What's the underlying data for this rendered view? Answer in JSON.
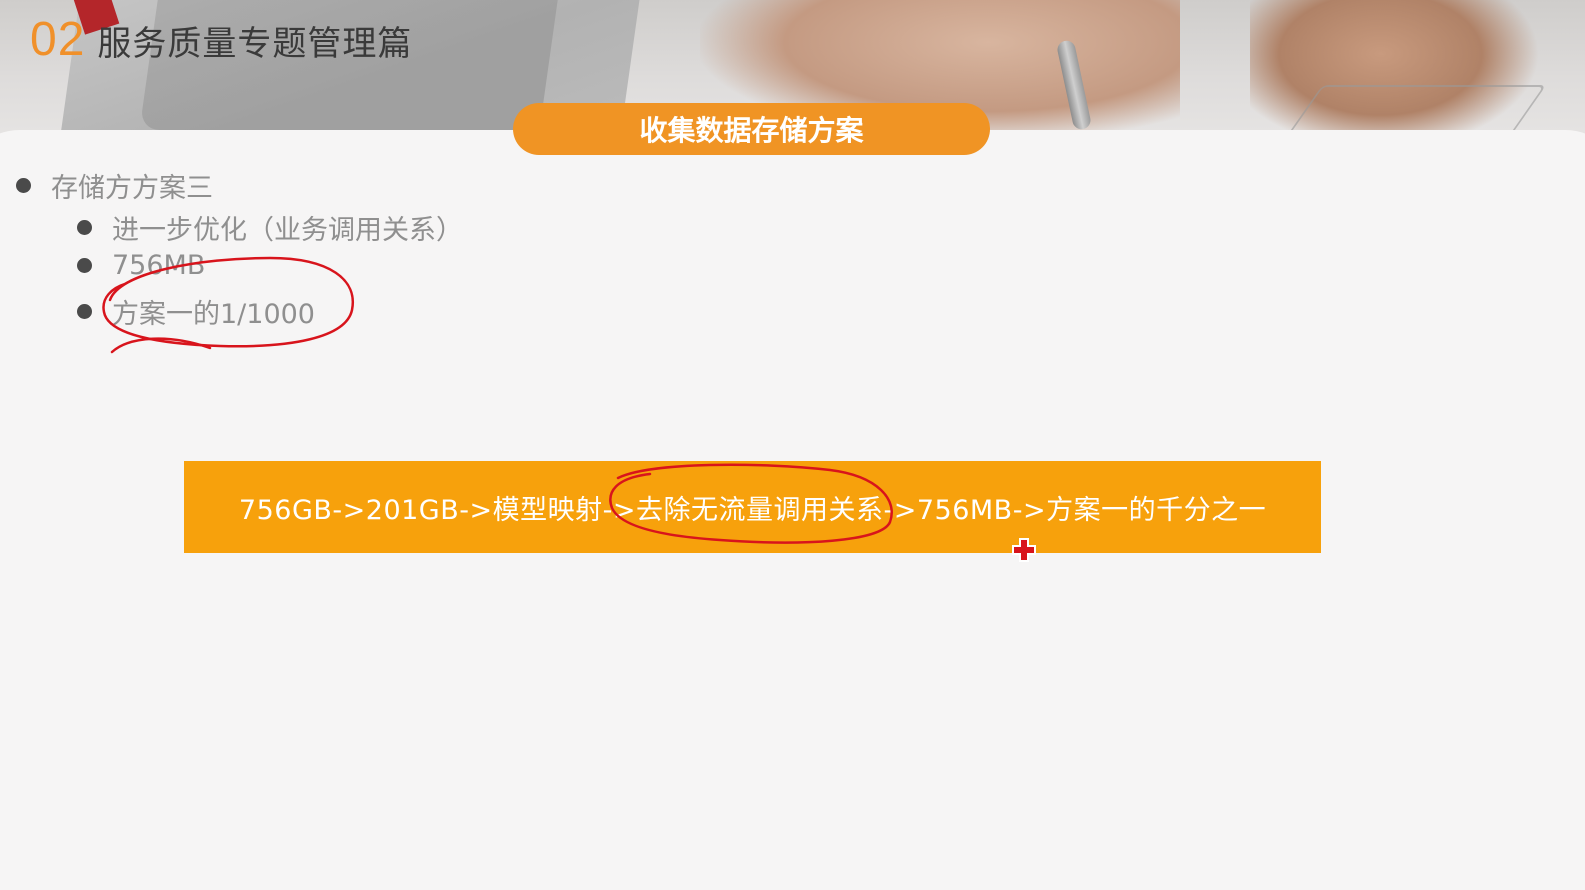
{
  "header": {
    "section_number": "02",
    "section_name": "服务质量专题管理篇"
  },
  "slide": {
    "heading": "收集数据存储方案",
    "bullets": [
      {
        "text": "存储方方案三",
        "children": [
          "进一步优化（业务调用关系）",
          "756MB",
          "方案一的1/1000"
        ]
      }
    ],
    "flow_text": "756GB->201GB->模型映射->去除无流量调用关系->756MB->方案一的千分之一"
  },
  "colors": {
    "accent_orange": "#f09424",
    "banner_orange": "#f7a10c",
    "annotation_red": "#d8141c"
  },
  "icons": {
    "cursor": "red-cross-cursor-icon"
  }
}
